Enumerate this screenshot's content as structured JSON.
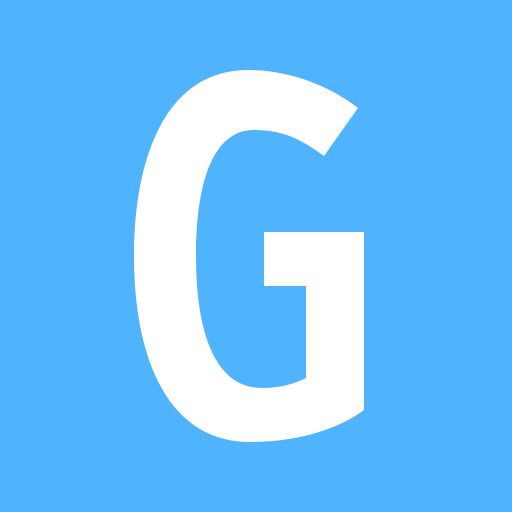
{
  "icon": {
    "letter": "G",
    "background_color": "#4FB3FE",
    "foreground_color": "#FFFFFF"
  }
}
